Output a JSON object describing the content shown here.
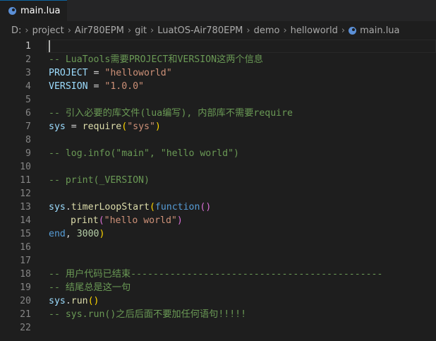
{
  "tab": {
    "label": "main.lua",
    "close": "×",
    "icon": "lua-moon-icon"
  },
  "breadcrumb": [
    "D:",
    "project",
    "Air780EPM",
    "git",
    "LuatOS-Air780EPM",
    "demo",
    "helloworld"
  ],
  "breadcrumb_file": "main.lua",
  "breadcrumb_sep": "›",
  "colors": {
    "background": "#1e1e1e",
    "comment": "#6a9955",
    "variable": "#9cdcfe",
    "string": "#ce9178",
    "function": "#dcdcaa",
    "keyword": "#569cd6",
    "number": "#b5cea8",
    "bracket": "#ffd700"
  },
  "line_numbers": [
    "1",
    "2",
    "3",
    "4",
    "5",
    "6",
    "7",
    "8",
    "9",
    "10",
    "11",
    "12",
    "13",
    "14",
    "15",
    "16",
    "17",
    "18",
    "19",
    "20",
    "21",
    "22"
  ],
  "code": {
    "l2": "-- LuaTools需要PROJECT和VERSION这两个信息",
    "l3_var": "PROJECT",
    "l3_op": " = ",
    "l3_str": "\"helloworld\"",
    "l4_var": "VERSION",
    "l4_op": " = ",
    "l4_str": "\"1.0.0\"",
    "l6": "-- 引入必要的库文件(lua编写), 内部库不需要require",
    "l7_var": "sys",
    "l7_op": " = ",
    "l7_fn": "require",
    "l7_open": "(",
    "l7_str": "\"sys\"",
    "l7_close": ")",
    "l9": "-- log.info(\"main\", \"hello world\")",
    "l11": "-- print(_VERSION)",
    "l13_var": "sys",
    "l13_dot": ".",
    "l13_fn": "timerLoopStart",
    "l13_open": "(",
    "l13_kw": "function",
    "l13_p": "()",
    "l14_fn": "print",
    "l14_open": "(",
    "l14_str": "\"hello world\"",
    "l14_close": ")",
    "l15_kw": "end",
    "l15_comma": ", ",
    "l15_num": "3000",
    "l15_close": ")",
    "l18": "-- 用户代码已结束---------------------------------------------",
    "l19": "-- 结尾总是这一句",
    "l20_var": "sys",
    "l20_dot": ".",
    "l20_fn": "run",
    "l20_p": "()",
    "l21": "-- sys.run()之后后面不要加任何语句!!!!!"
  }
}
